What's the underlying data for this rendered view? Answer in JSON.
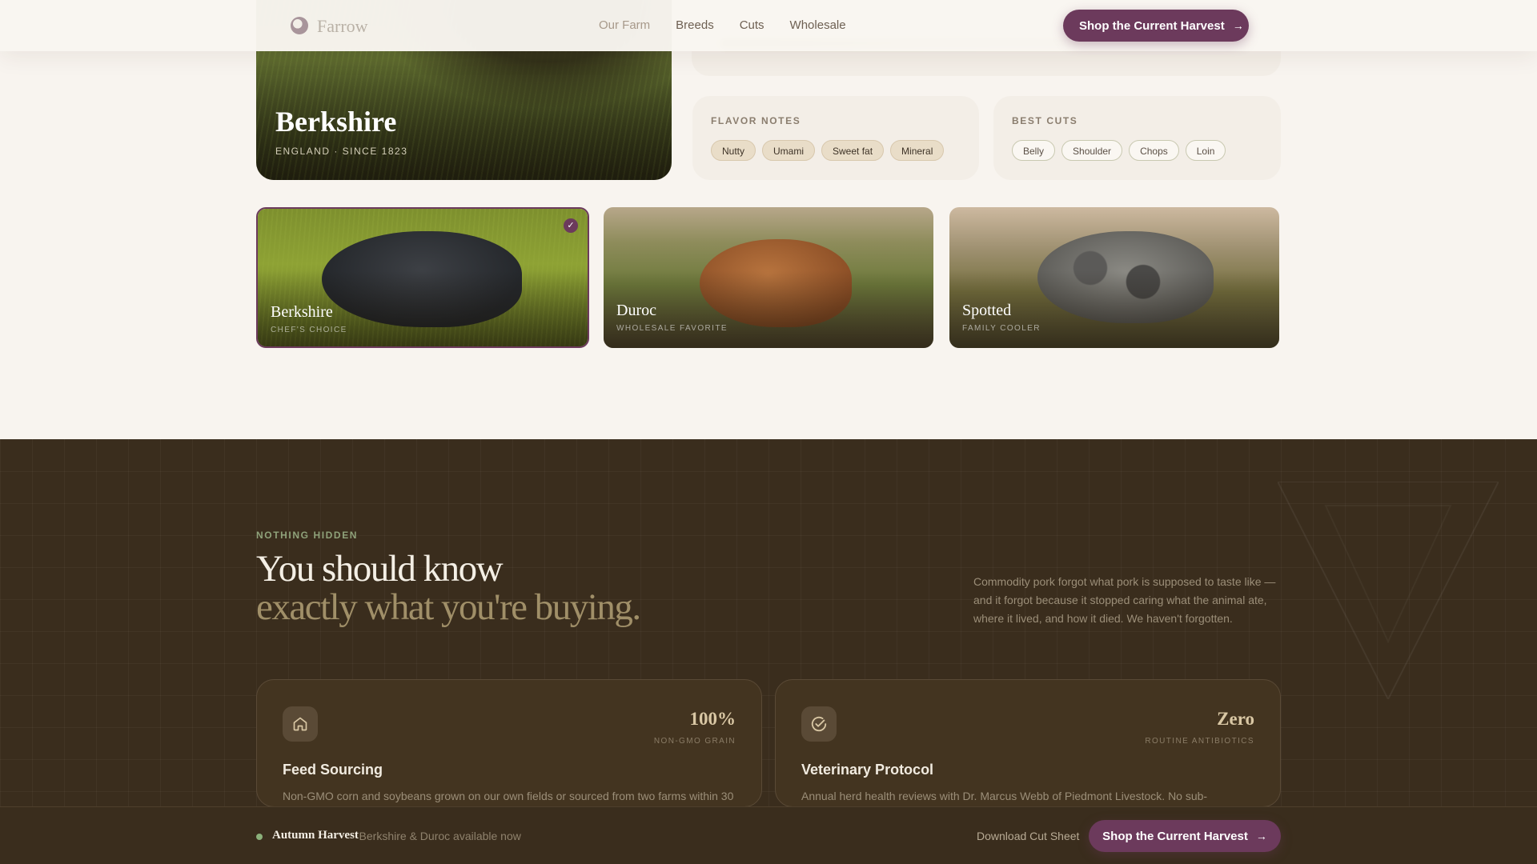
{
  "header": {
    "brand": "Farrow",
    "nav": [
      "Our Farm",
      "Breeds",
      "Cuts",
      "Wholesale"
    ],
    "cta": "Shop the Current Harvest"
  },
  "hero": {
    "title": "Berkshire",
    "subtitle": "ENGLAND · SINCE 1823"
  },
  "flavor": {
    "label": "FLAVOR NOTES",
    "chips": [
      "Nutty",
      "Umami",
      "Sweet fat",
      "Mineral"
    ]
  },
  "cuts": {
    "label": "BEST CUTS",
    "chips": [
      "Belly",
      "Shoulder",
      "Chops",
      "Loin"
    ]
  },
  "breeds": [
    {
      "name": "Berkshire",
      "tag": "CHEF'S CHOICE",
      "selected": true
    },
    {
      "name": "Duroc",
      "tag": "WHOLESALE FAVORITE",
      "selected": false
    },
    {
      "name": "Spotted",
      "tag": "FAMILY COOLER",
      "selected": false
    }
  ],
  "section": {
    "eyebrow": "NOTHING HIDDEN",
    "headline_line1": "You should know",
    "headline_line2": "exactly what you're buying.",
    "blurb": "Commodity pork forgot what pork is supposed to taste like — and it forgot because it stopped caring what the animal ate, where it lived, and how it died. We haven't forgotten."
  },
  "stats": [
    {
      "icon": "home-icon",
      "value": "100%",
      "caption": "NON-GMO GRAIN",
      "title": "Feed Sourcing",
      "desc": "Non-GMO corn and soybeans grown on our own fields or sourced from two farms within 30"
    },
    {
      "icon": "check-circle-icon",
      "value": "Zero",
      "caption": "ROUTINE ANTIBIOTICS",
      "title": "Veterinary Protocol",
      "desc": "Annual herd health reviews with Dr. Marcus Webb of Piedmont Livestock. No sub-"
    }
  ],
  "bottom_bar": {
    "title": "Autumn Harvest",
    "subtitle": "· Berkshire & Duroc available now",
    "download": "Download Cut Sheet",
    "cta": "Shop the Current Harvest"
  },
  "colors": {
    "accent": "#6c3a5c",
    "dark_bg": "#3a2d1d",
    "page_bg": "#f8f4ef"
  }
}
